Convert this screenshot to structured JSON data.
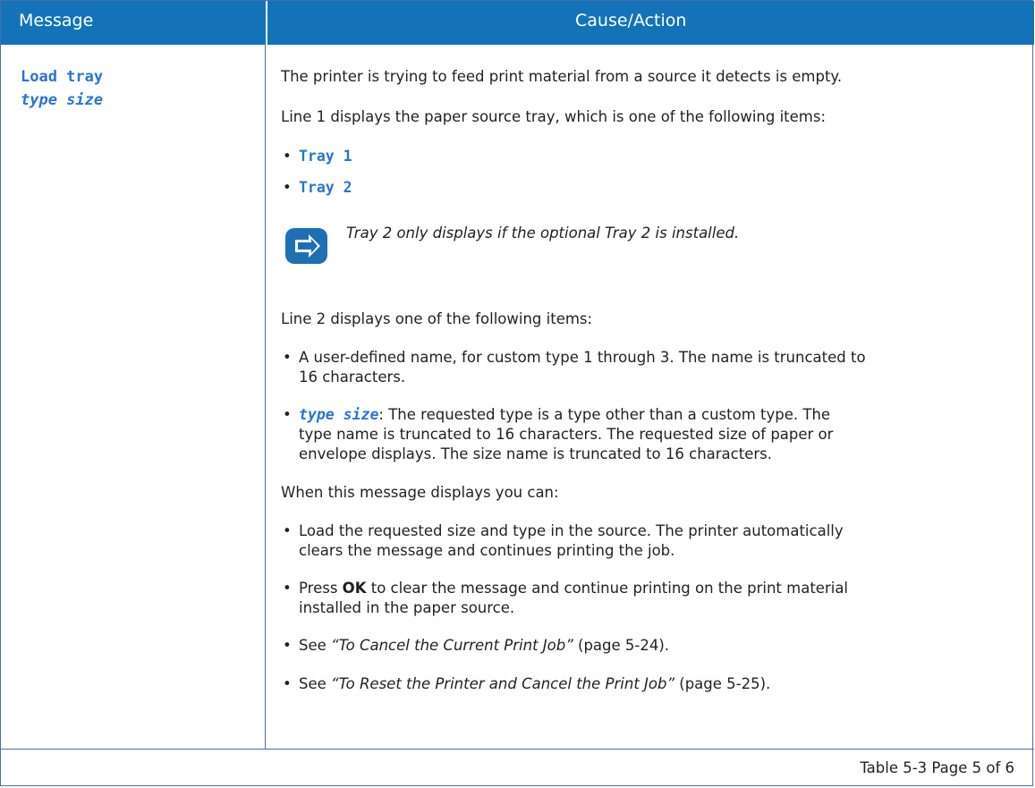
{
  "header": {
    "message": "Message",
    "cause_action": "Cause/Action"
  },
  "message": {
    "line1": "Load tray",
    "line2": "type size"
  },
  "cause": {
    "intro": "The printer is trying to feed print material from a source it detects is empty.",
    "line1_intro": "Line 1 displays the paper source tray, which is one of the following items:",
    "trays": [
      "Tray 1",
      "Tray 2"
    ],
    "note": "Tray 2 only displays if the optional Tray 2 is installed.",
    "line2_intro": "Line 2 displays one of the following items:",
    "line2_items": {
      "custom_1": "A user-defined name, for custom type 1 through 3. The name is truncated to",
      "custom_2": "16 characters.",
      "typesize_code": "type size",
      "typesize_1": ": The requested type is a type other than a custom type. The",
      "typesize_2": "type name is truncated to 16 characters. The requested size of paper or",
      "typesize_3": "envelope displays. The size name is truncated to 16 characters."
    },
    "when_intro": "When this message displays you can:",
    "actions": {
      "load_1": "Load the requested size and type in the source. The printer automatically",
      "load_2": "clears the message and continues printing the job.",
      "press_prefix": "Press ",
      "press_key": "OK",
      "press_1": " to clear the message and continue printing on the print material",
      "press_2": "installed in the paper source.",
      "see1_prefix": "See ",
      "see1_link": "“To Cancel the Current Print Job”",
      "see1_suffix": " (page 5-24).",
      "see2_prefix": "See ",
      "see2_link": "“To Reset the Printer and Cancel the Print Job”",
      "see2_suffix": " (page 5-25)."
    }
  },
  "footer": {
    "table_ref": "Table 5-3  Page 5 of 6"
  },
  "colors": {
    "header_bg": "#1473b8",
    "code_blue": "#2a73d6",
    "border": "#4a6fa5"
  },
  "icons": {
    "note": "note-arrow-icon"
  }
}
